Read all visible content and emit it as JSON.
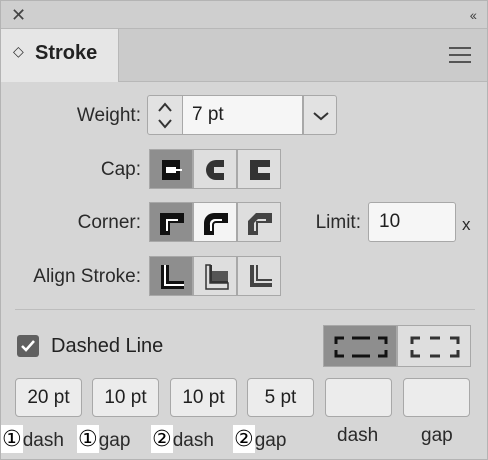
{
  "window": {
    "close_glyph": "✕",
    "collapse_glyph": "‹‹"
  },
  "tab": {
    "label": "Stroke",
    "chevron": "◇"
  },
  "weight": {
    "label": "Weight:",
    "value": "7 pt"
  },
  "cap": {
    "label": "Cap:",
    "options": [
      "butt-cap-icon",
      "round-cap-icon",
      "projecting-cap-icon"
    ],
    "selected_index": 0
  },
  "corner": {
    "label": "Corner:",
    "options": [
      "miter-join-icon",
      "round-join-icon",
      "bevel-join-icon"
    ],
    "selected_index": 0,
    "limit_label": "Limit:",
    "limit_value": "10",
    "limit_suffix": "x"
  },
  "align_stroke": {
    "label": "Align Stroke:",
    "options": [
      "align-center-icon",
      "align-inside-icon",
      "align-outside-icon"
    ],
    "selected_index": 0
  },
  "dashed_line": {
    "label": "Dashed Line",
    "checked": true,
    "style_options": [
      "preserve-dash-icon",
      "align-dash-to-corners-icon"
    ],
    "selected_style_index": 0
  },
  "dash_gap": {
    "fields": [
      {
        "value": "20 pt",
        "caption": "dash",
        "badge": "①"
      },
      {
        "value": "10 pt",
        "caption": "gap",
        "badge": "①"
      },
      {
        "value": "10 pt",
        "caption": "dash",
        "badge": "②"
      },
      {
        "value": "5 pt",
        "caption": "gap",
        "badge": "②"
      },
      {
        "value": "",
        "caption": "dash",
        "badge": ""
      },
      {
        "value": "",
        "caption": "gap",
        "badge": ""
      }
    ]
  },
  "colors": {
    "panel_bg": "#d6d6d6",
    "selected_button": "#8e8e8e",
    "field_bg": "#f6f6f6"
  }
}
